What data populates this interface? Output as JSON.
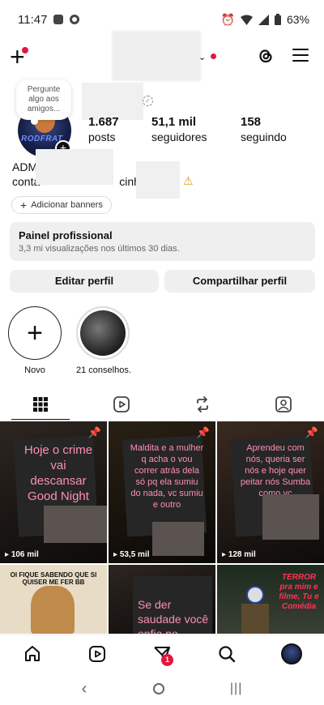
{
  "status_bar": {
    "time": "11:47",
    "battery": "63%"
  },
  "topbar": {
    "add_label": "+"
  },
  "profile": {
    "note": "Pergunte algo aos amigos...",
    "avatar_text": "RODFRAT",
    "stats": [
      {
        "value": "1.687",
        "label": "posts"
      },
      {
        "value": "51,1 mil",
        "label": "seguidores"
      },
      {
        "value": "158",
        "label": "seguindo"
      }
    ],
    "bio_line1": "ADM",
    "bio_line2_start": "conta",
    "bio_line2_end": "cinho",
    "add_banner": "Adicionar banners"
  },
  "dashboard": {
    "title": "Painel profissional",
    "subtitle": "3,3 mi visualizações nos últimos 30 dias."
  },
  "buttons": {
    "edit": "Editar perfil",
    "share": "Compartilhar perfil"
  },
  "highlights": [
    {
      "label": "Novo"
    },
    {
      "label": "21 conselhos."
    }
  ],
  "grid": {
    "posts": [
      {
        "text": "Hoje o crime vai descansar Good Night",
        "views": "106 mil"
      },
      {
        "text": "Maldita e a mulher q acha o vou correr atrás dela só pq ela sumiu do nada, vc sumiu e outro",
        "views": "53,5 mil"
      },
      {
        "text": "Aprendeu com nós, queria ser nós e hoje quer peitar nós Sumba como vc",
        "views": "128 mil"
      }
    ],
    "row2": [
      {
        "text": "OI FIQUE SABENDO QUE SI QUISER ME FER BB"
      },
      {
        "text": "Se der saudade você enfia no"
      },
      {
        "text": "TERROR pra mim e filme, Tu e Comédia"
      }
    ]
  },
  "nav": {
    "badge": "1"
  }
}
